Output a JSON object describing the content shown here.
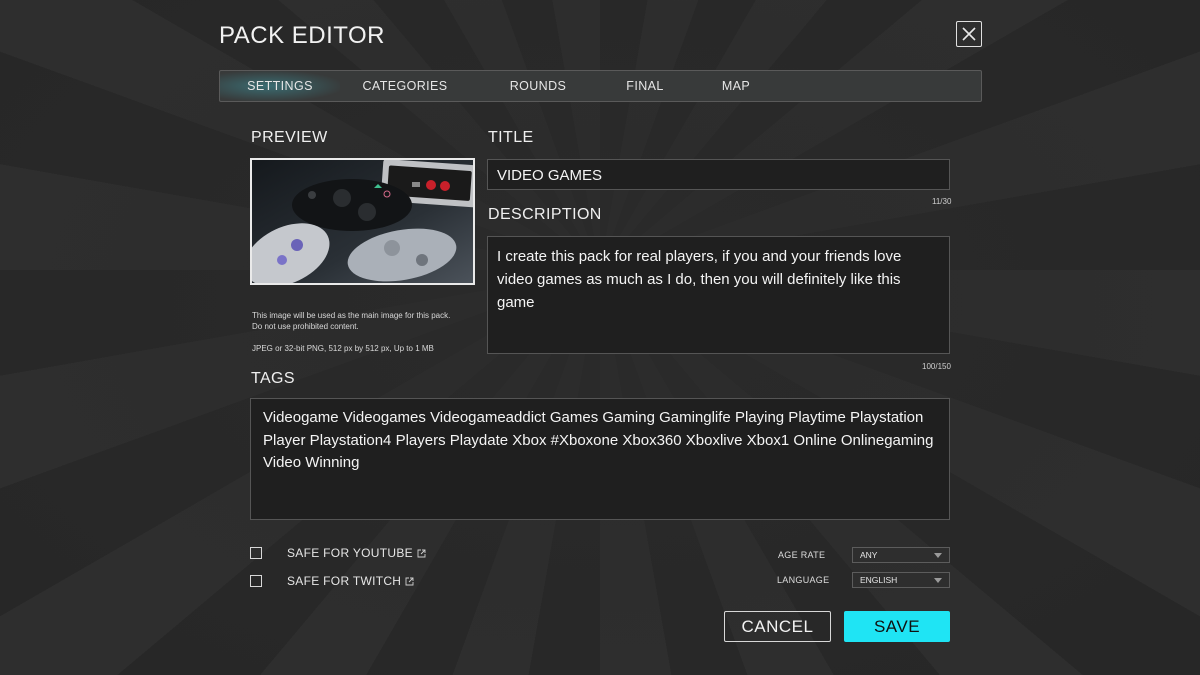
{
  "header": {
    "title": "PACK EDITOR"
  },
  "tabs": [
    {
      "label": "SETTINGS",
      "active": true
    },
    {
      "label": "CATEGORIES",
      "active": false
    },
    {
      "label": "ROUNDS",
      "active": false
    },
    {
      "label": "FINAL",
      "active": false
    },
    {
      "label": "MAP",
      "active": false
    }
  ],
  "preview": {
    "label": "PREVIEW",
    "note_line1": "This image will be used as the main image for this pack.",
    "note_line2": "Do not use prohibited content.",
    "format_note": "JPEG or 32-bit PNG, 512 px by 512 px, Up to 1 MB"
  },
  "title_field": {
    "label": "TITLE",
    "value": "VIDEO GAMES",
    "counter": "11/30"
  },
  "description_field": {
    "label": "DESCRIPTION",
    "value": "I create this pack for real players, if you and your friends love video games as much as I do, then you will definitely like this game",
    "counter": "100/150"
  },
  "tags_field": {
    "label": "TAGS",
    "value": "Videogame Videogames Videogameaddict Games Gaming Gaminglife  Playing Playtime Playstation Player Playstation4 Players Playdate Xbox #Xboxone Xbox360 Xboxlive Xbox1 Online Onlinegaming Video Winning"
  },
  "options": {
    "safe_youtube": {
      "label": "SAFE FOR YOUTUBE",
      "checked": false
    },
    "safe_twitch": {
      "label": "SAFE FOR TWITCH",
      "checked": false
    },
    "age_rate": {
      "label": "AGE RATE",
      "value": "ANY"
    },
    "language": {
      "label": "LANGUAGE",
      "value": "ENGLISH"
    }
  },
  "actions": {
    "cancel": "CANCEL",
    "save": "SAVE"
  },
  "colors": {
    "accent": "#1fe4f4",
    "background": "#2b2b2b",
    "field_bg": "#1f1f1f"
  },
  "icons": [
    "close-icon",
    "external-link-icon",
    "chevron-down-icon"
  ]
}
